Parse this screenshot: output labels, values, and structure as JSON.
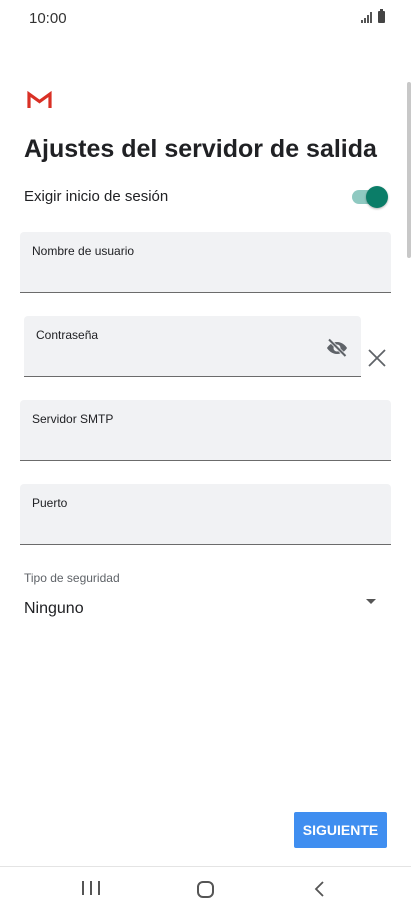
{
  "status_bar": {
    "time": "10:00",
    "signal_icon": "signal-icon",
    "battery_icon": "battery-icon"
  },
  "app": {
    "logo_icon": "gmail-logo-icon",
    "brand_color": "#d93025"
  },
  "page": {
    "title": "Ajustes del servidor de salida"
  },
  "require_login": {
    "label": "Exigir inicio de sesión",
    "enabled": true,
    "accent_color": "#0b7d68"
  },
  "fields": {
    "username": {
      "label": "Nombre de usuario",
      "value": ""
    },
    "password": {
      "label": "Contraseña",
      "value": "",
      "visibility_icon": "eye-off-icon",
      "clear_icon": "close-icon"
    },
    "smtp_server": {
      "label": "Servidor SMTP",
      "value": ""
    },
    "port": {
      "label": "Puerto",
      "value": ""
    }
  },
  "security": {
    "label": "Tipo de seguridad",
    "selected": "Ninguno",
    "dropdown_icon": "dropdown-arrow-icon"
  },
  "actions": {
    "next_label": "SIGUIENTE",
    "next_color": "#3f8ef0"
  },
  "nav_bar": {
    "recents_icon": "recents-icon",
    "home_icon": "home-icon",
    "back_icon": "back-icon"
  }
}
